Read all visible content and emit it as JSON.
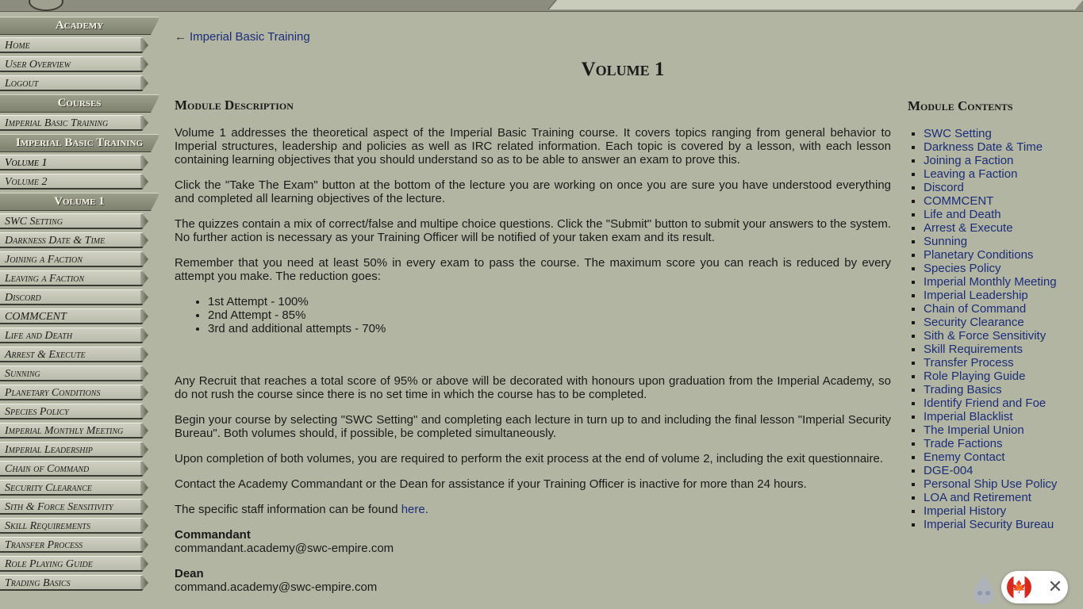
{
  "sidebar": {
    "sections": [
      {
        "heading": "Academy",
        "items": [
          "Home",
          "User Overview",
          "Logout"
        ]
      },
      {
        "heading": "Courses",
        "items": [
          "Imperial Basic Training"
        ]
      },
      {
        "heading": "Imperial Basic Training",
        "items": [
          "Volume 1",
          "Volume 2"
        ]
      },
      {
        "heading": "Volume 1",
        "items": [
          "SWC Setting",
          "Darkness Date & Time",
          "Joining a Faction",
          "Leaving a Faction",
          "Discord",
          "COMMCENT",
          "Life and Death",
          "Arrest & Execute",
          "Sunning",
          "Planetary Conditions",
          "Species Policy",
          "Imperial Monthly Meeting",
          "Imperial Leadership",
          "Chain of Command",
          "Security Clearance",
          "Sith & Force Sensitivity",
          "Skill Requirements",
          "Transfer Process",
          "Role Playing Guide",
          "Trading Basics"
        ]
      }
    ]
  },
  "main": {
    "back_arrow": "←",
    "back_label": "Imperial Basic Training",
    "title": "Volume 1",
    "description_heading": "Module Description",
    "p1": "Volume 1 addresses the theoretical aspect of the Imperial Basic Training course. It covers topics ranging from general behavior to Imperial structures, leadership and policies as well as IRC related information. Each topic is covered by a lesson, with each lesson containing learning objectives that you should understand so as to be able to answer an exam to prove this.",
    "p2": "Click the \"Take The Exam\" button at the bottom of the lecture you are working on once you are sure you have understood everything and completed all learning objectives of the lecture.",
    "p3": "The quizzes contain a mix of correct/false and multipe choice questions. Click the \"Submit\" button to submit your answers to the system. No further action is necessary as your Training Officer will be notified of your taken exam and its result.",
    "p4": "Remember that you need at least 50% in every exam to pass the course. The maximum score you can reach is reduced by every attempt you make. The reduction goes:",
    "attempts": [
      "1st Attempt - 100%",
      "2nd Attempt - 85%",
      "3rd and additional attempts - 70%"
    ],
    "p5": "Any Recruit that reaches a total score of 95% or above will be decorated with honours upon graduation from the Imperial Academy, so do not rush the course since there is no set time in which the course has to be completed.",
    "p6": "Begin your course by selecting \"SWC Setting\" and completing each lecture in turn up to and including the final lesson \"Imperial Security Bureau\". Both volumes should, if possible, be completed simultaneously.",
    "p7": "Upon completion of both volumes, you are required to perform the exit process at the end of volume 2, including the exit questionnaire.",
    "p8": "Contact the Academy Commandant or the Dean for assistance if your Training Officer is inactive for more than 24 hours.",
    "p9_text": "The specific staff information can be found ",
    "p9_link": "here.",
    "contacts": [
      {
        "role": "Commandant",
        "email": "commandant.academy@swc-empire.com"
      },
      {
        "role": "Dean",
        "email": "command.academy@swc-empire.com"
      }
    ]
  },
  "contents": {
    "heading": "Module Contents",
    "items": [
      "SWC Setting",
      "Darkness Date & Time",
      "Joining a Faction",
      "Leaving a Faction",
      "Discord",
      "COMMCENT",
      "Life and Death",
      "Arrest & Execute",
      "Sunning",
      "Planetary Conditions",
      "Species Policy",
      "Imperial Monthly Meeting",
      "Imperial Leadership",
      "Chain of Command",
      "Security Clearance",
      "Sith & Force Sensitivity",
      "Skill Requirements",
      "Transfer Process",
      "Role Playing Guide",
      "Trading Basics",
      "Identify Friend and Foe",
      "Imperial Blacklist",
      "The Imperial Union",
      "Trade Factions",
      "Enemy Contact",
      "DGE-004",
      "Personal Ship Use Policy",
      "LOA and Retirement",
      "Imperial History",
      "Imperial Security Bureau"
    ]
  },
  "widget": {
    "flag": "🍁",
    "close": "✕"
  }
}
